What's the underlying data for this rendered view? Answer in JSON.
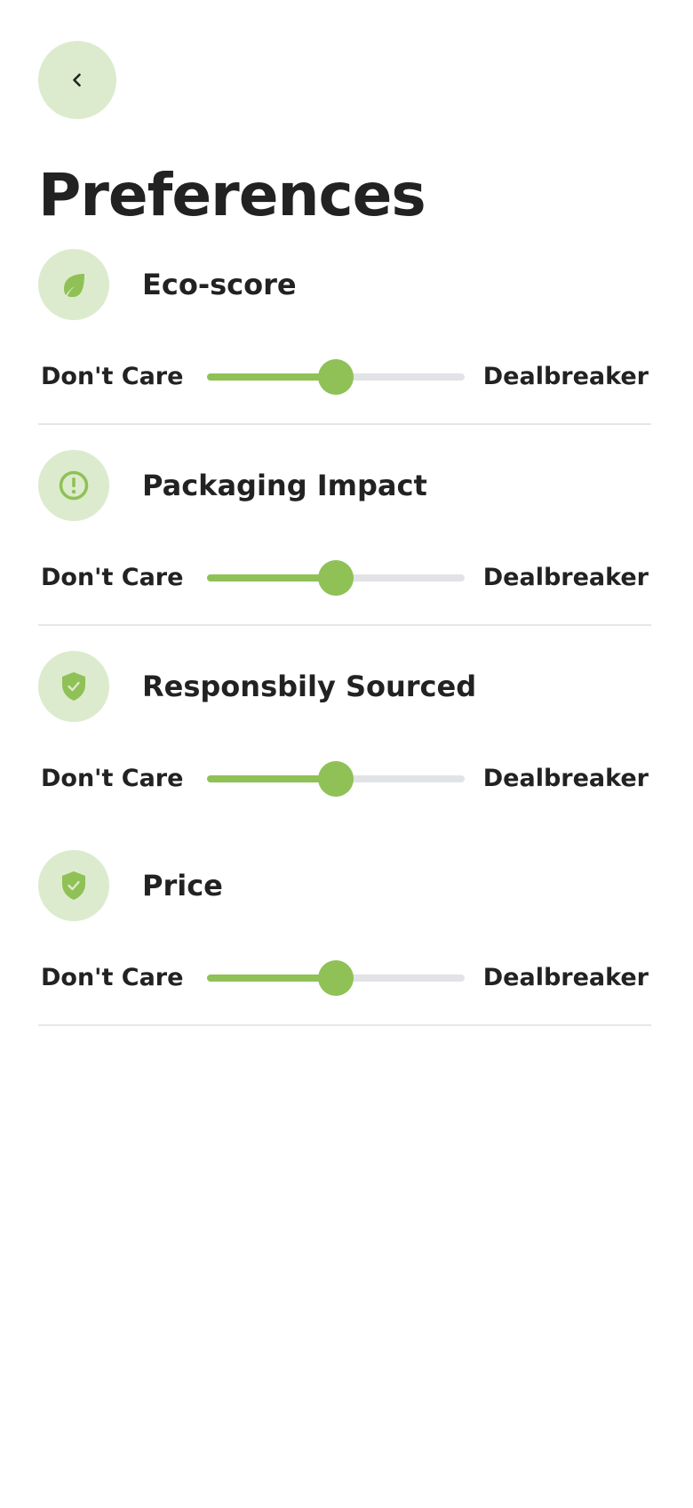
{
  "header": {
    "back_icon": "chevron-left-icon",
    "title": "Preferences"
  },
  "colors": {
    "accent": "#8fc156",
    "accent_light": "#dcebcd",
    "track": "#e2e3e6",
    "text": "#222222"
  },
  "preferences": [
    {
      "title": "Eco-score",
      "icon": "leaf-icon",
      "min_label": "Don't Care",
      "max_label": "Dealbreaker",
      "value": 0.5
    },
    {
      "title": "Packaging Impact",
      "icon": "alert-circle-icon",
      "min_label": "Don't Care",
      "max_label": "Dealbreaker",
      "value": 0.5
    },
    {
      "title": "Responsbily Sourced",
      "icon": "shield-check-icon",
      "min_label": "Don't Care",
      "max_label": "Dealbreaker",
      "value": 0.5
    },
    {
      "title": "Price",
      "icon": "shield-check-icon",
      "min_label": "Don't Care",
      "max_label": "Dealbreaker",
      "value": 0.5
    }
  ]
}
